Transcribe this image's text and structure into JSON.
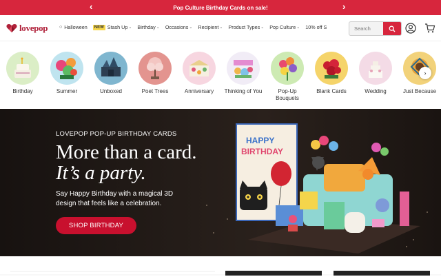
{
  "promo": {
    "text": "Pop Culture Birthday Cards on sale!",
    "prev_icon": "chevron-left-icon",
    "next_icon": "chevron-right-icon"
  },
  "header": {
    "logo_text": "lovepop",
    "menu": {
      "halloween": "Halloween",
      "new_badge": "NEW",
      "stash_up": "Stash Up",
      "birthday": "Birthday",
      "occasions": "Occasions",
      "recipient": "Recipient",
      "product_types": "Product Types",
      "pop_culture": "Pop Culture",
      "promo": "10% off S"
    },
    "search": {
      "placeholder": "Search"
    }
  },
  "categories": [
    {
      "label": "Birthday"
    },
    {
      "label": "Summer"
    },
    {
      "label": "Unboxed"
    },
    {
      "label": "Poet Trees"
    },
    {
      "label": "Anniversary"
    },
    {
      "label": "Thinking of You"
    },
    {
      "label": "Pop-Up Bouquets"
    },
    {
      "label": "Blank Cards"
    },
    {
      "label": "Wedding"
    },
    {
      "label": "Just Because"
    }
  ],
  "hero": {
    "eyebrow": "LOVEPOP POP-UP BIRTHDAY CARDS",
    "title_line1": "More than a card.",
    "title_line2": "It’s a party.",
    "description": "Say Happy Birthday with a magical 3D design that feels like a celebration.",
    "cta": "SHOP BIRTHDAY",
    "card_text_line1": "HAPPY",
    "card_text_line2": "BIRTHDAY"
  },
  "colors": {
    "brand": "#d7263d",
    "cta": "#c8102e",
    "hero_bg": "#1d1714"
  }
}
